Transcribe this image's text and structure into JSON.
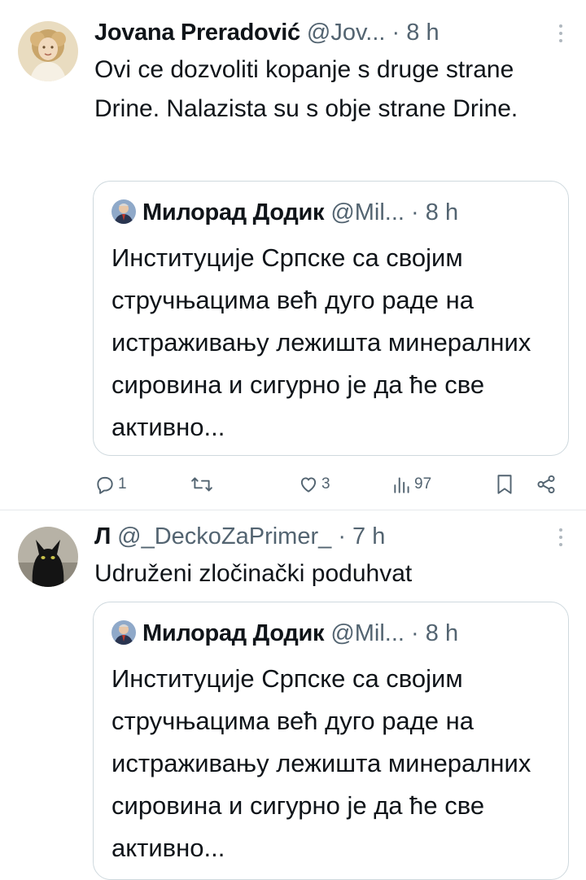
{
  "tweets": [
    {
      "author": "Jovana Preradović",
      "handle": "@Jov...",
      "separator": "·",
      "time": "8 h",
      "text": "Ovi ce dozvoliti kopanje s druge strane Drine. Nalazista su s obje strane Drine.",
      "quote": {
        "author": "Милорад Додик",
        "handle": "@Mil...",
        "separator": "·",
        "time": "8 h",
        "text": "Институције Српске са својим стручњацима већ дуго раде на истраживању лежишта минералних сировина и сигурно је да ће све активно..."
      },
      "actions": {
        "replies": "1",
        "reposts": "",
        "likes": "3",
        "views": "97"
      }
    },
    {
      "author": "Л",
      "handle": "@_DeckoZaPrimer_",
      "separator": "·",
      "time": "7 h",
      "text": "Udruženi zločinački poduhvat",
      "quote": {
        "author": "Милорад Додик",
        "handle": "@Mil...",
        "separator": "·",
        "time": "8 h",
        "text": "Институције Српске са својим стручњацима већ дуго раде на истраживању лежишта минералних сировина и сигурно је да ће све активно..."
      }
    }
  ],
  "icons": {
    "reply": "reply-icon",
    "repost": "repost-icon",
    "like": "heart-icon",
    "views": "views-chart-icon",
    "bookmark": "bookmark-icon",
    "share": "share-icon",
    "more": "more-vertical-icon"
  },
  "colors": {
    "text": "#0f1419",
    "secondary": "#536471",
    "border": "#cfd9de",
    "divider": "#e6e9ec"
  }
}
